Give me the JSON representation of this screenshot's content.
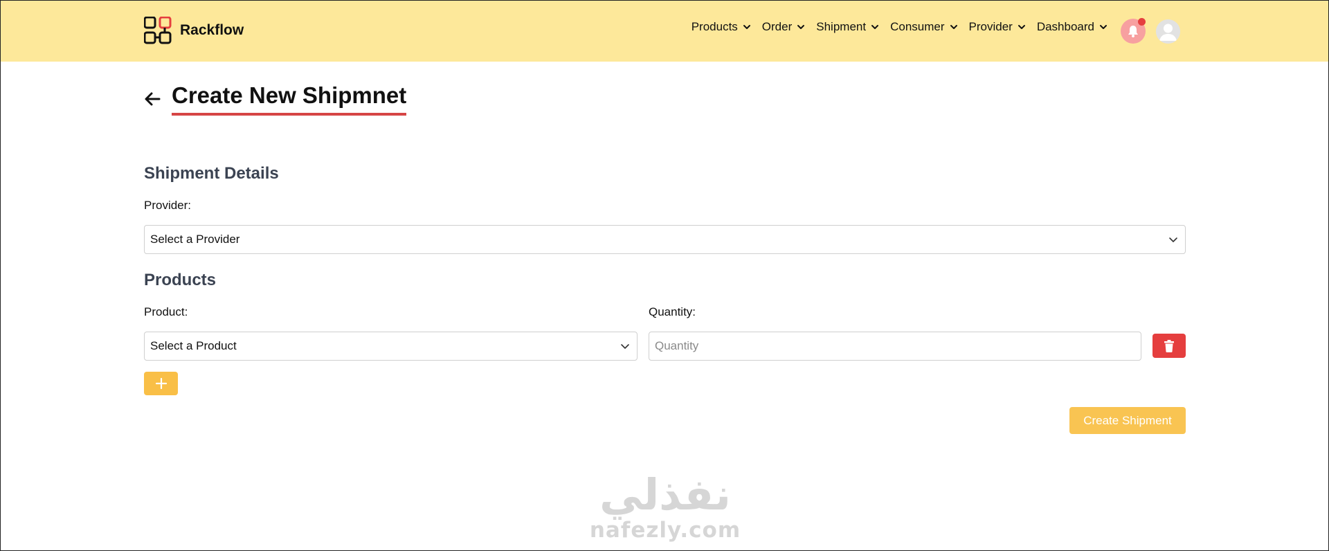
{
  "brand": {
    "name": "Rackflow",
    "logo_icon": "grid-logo-icon",
    "accent_color": "#e53e3e"
  },
  "nav": {
    "items": [
      {
        "label": "Products"
      },
      {
        "label": "Order"
      },
      {
        "label": "Shipment"
      },
      {
        "label": "Consumer"
      },
      {
        "label": "Provider"
      },
      {
        "label": "Dashboard"
      }
    ]
  },
  "header_icons": {
    "notifications": "bell-icon",
    "profile": "user-avatar-icon"
  },
  "page": {
    "title": "Create New Shipmnet"
  },
  "shipment_details": {
    "heading": "Shipment Details",
    "provider_label": "Provider:",
    "provider_select_value": "Select a Provider"
  },
  "products": {
    "heading": "Products",
    "product_label": "Product:",
    "quantity_label": "Quantity:",
    "product_select_value": "Select a Product",
    "quantity_placeholder": "Quantity",
    "quantity_value": ""
  },
  "actions": {
    "add_button_icon": "plus-icon",
    "delete_button_icon": "trash-icon",
    "create_button_label": "Create Shipment"
  },
  "watermark": {
    "arabic": "نفذلي",
    "latin": "nafezly.com"
  },
  "colors": {
    "header_bg": "#fde89a",
    "title_underline": "#d64545",
    "danger": "#e53e3e",
    "primary_button": "#f9bf47",
    "section_heading": "#3b4352"
  }
}
